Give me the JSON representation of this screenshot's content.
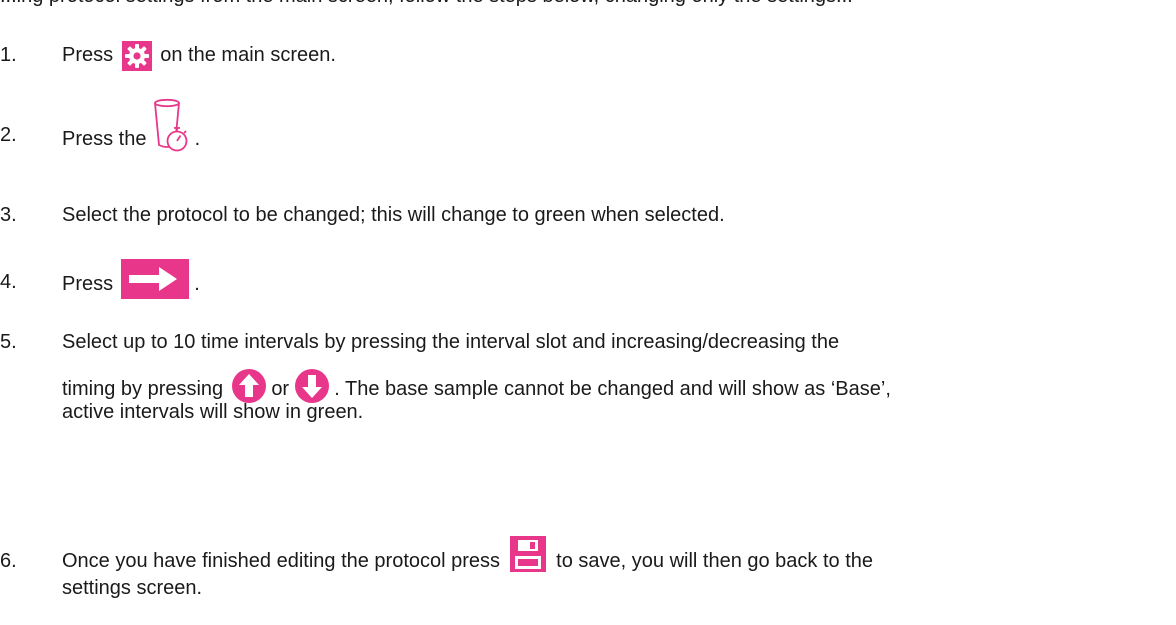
{
  "intro_text": "...ing protocol settings from the main screen, follow the steps below, changing only the settings...",
  "colors": {
    "accent": "#e8378a",
    "text": "#1a1a1a"
  },
  "steps": [
    {
      "num": "1.",
      "before": "Press",
      "icon": "gear-icon",
      "after": "on the main screen."
    },
    {
      "num": "2.",
      "before": "Press the",
      "icon": "cup-timer-icon",
      "after": "."
    },
    {
      "num": "3.",
      "text": "Select the protocol to be changed; this will change to green when selected."
    },
    {
      "num": "4.",
      "before": "Press",
      "icon": "arrow-right-icon",
      "after": "."
    },
    {
      "num": "5.",
      "line1": "Select up to 10 time intervals by pressing the interval slot and increasing/decreasing the",
      "line2_before": "timing by pressing",
      "icon_up": "arrow-up-icon",
      "line2_or": "or",
      "icon_down": "arrow-down-icon",
      "line2_after": ". The base sample cannot be changed and will show as ‘Base’,",
      "line3": "active intervals will show in green."
    },
    {
      "num": "6.",
      "line1_before": "Once you have finished editing the protocol press",
      "icon": "save-icon",
      "line1_after": "to save, you will then go back to the",
      "line2": "settings screen."
    }
  ]
}
